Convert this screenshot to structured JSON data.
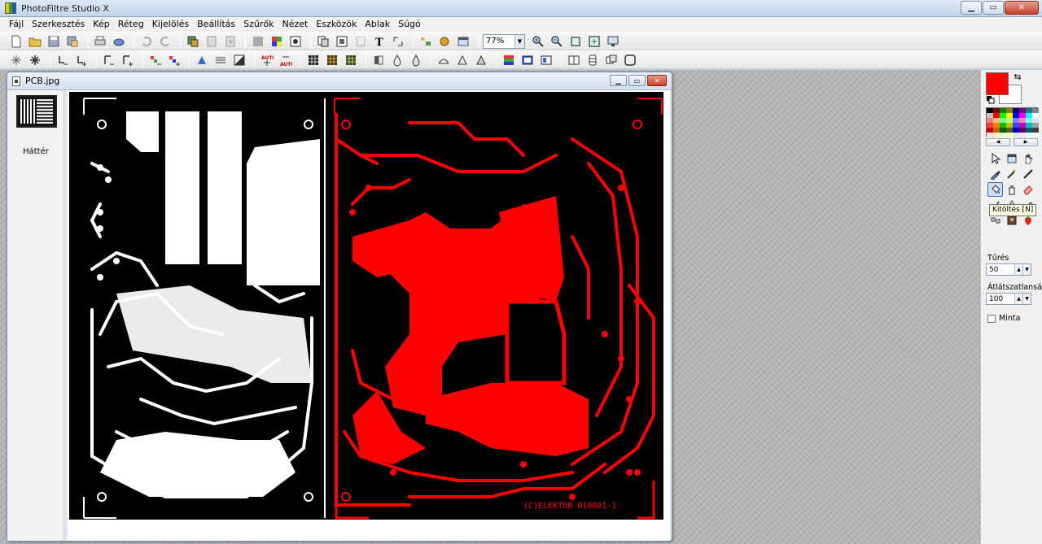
{
  "window": {
    "title": "PhotoFiltre Studio X"
  },
  "menu": [
    "Fájl",
    "Szerkesztés",
    "Kép",
    "Réteg",
    "Kijelölés",
    "Beállítás",
    "Szűrők",
    "Nézet",
    "Eszközök",
    "Ablak",
    "Súgó"
  ],
  "toolbar": {
    "zoom_value": "77%"
  },
  "document": {
    "title": "PCB.jpg",
    "layer_name": "Háttér"
  },
  "board": {
    "copyright_text": "(C)ELEKTOR 010601-1",
    "colors": {
      "board": "#000000",
      "silk": "#ffffff",
      "copper": "#ff0000"
    }
  },
  "tools_panel": {
    "foreground_color": "#ff0000",
    "background_color": "#ffffff",
    "tooltip": "Kitöltés [N]",
    "tolerance_label": "Tűrés",
    "tolerance_value": "50",
    "opacity_label": "Átlátszatlanság",
    "opacity_value": "100",
    "pattern_label": "Minta"
  }
}
